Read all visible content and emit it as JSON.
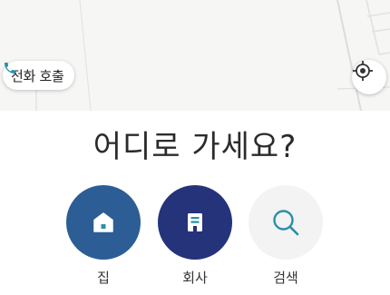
{
  "call_chip": {
    "label": "전화 호출",
    "icon": "phone-icon"
  },
  "locate_button": {
    "icon": "crosshair-location-icon"
  },
  "question": "어디로 가세요?",
  "quick_buttons": [
    {
      "label": "집",
      "icon": "home-icon",
      "color": "#2c5e95"
    },
    {
      "label": "회사",
      "icon": "building-icon",
      "color": "#25337a"
    },
    {
      "label": "검색",
      "icon": "search-icon",
      "color": "#f3f3f3"
    }
  ],
  "colors": {
    "accent_teal": "#2a8fa8",
    "map_background": "#f6f6f4"
  }
}
